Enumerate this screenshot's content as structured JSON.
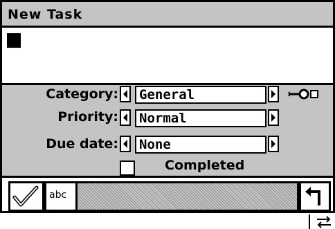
{
  "window": {
    "title": "New Task"
  },
  "form": {
    "category": {
      "label": "Category:",
      "value": "General"
    },
    "priority": {
      "label": "Priority:",
      "value": "Normal"
    },
    "due_date": {
      "label": "Due date:",
      "value": "None"
    },
    "completed": {
      "label": "Completed",
      "checked": false
    }
  },
  "toolbar": {
    "spell_check_label": "abc"
  },
  "icons": {
    "check": "checkmark-icon",
    "spell": "spell-check-icon",
    "back": "return-arrow-icon",
    "key": "key-icon",
    "swap": "swap-arrows-icon"
  },
  "colors": {
    "panel": "#c4c4c4",
    "text": "#000000",
    "background": "#ffffff"
  }
}
